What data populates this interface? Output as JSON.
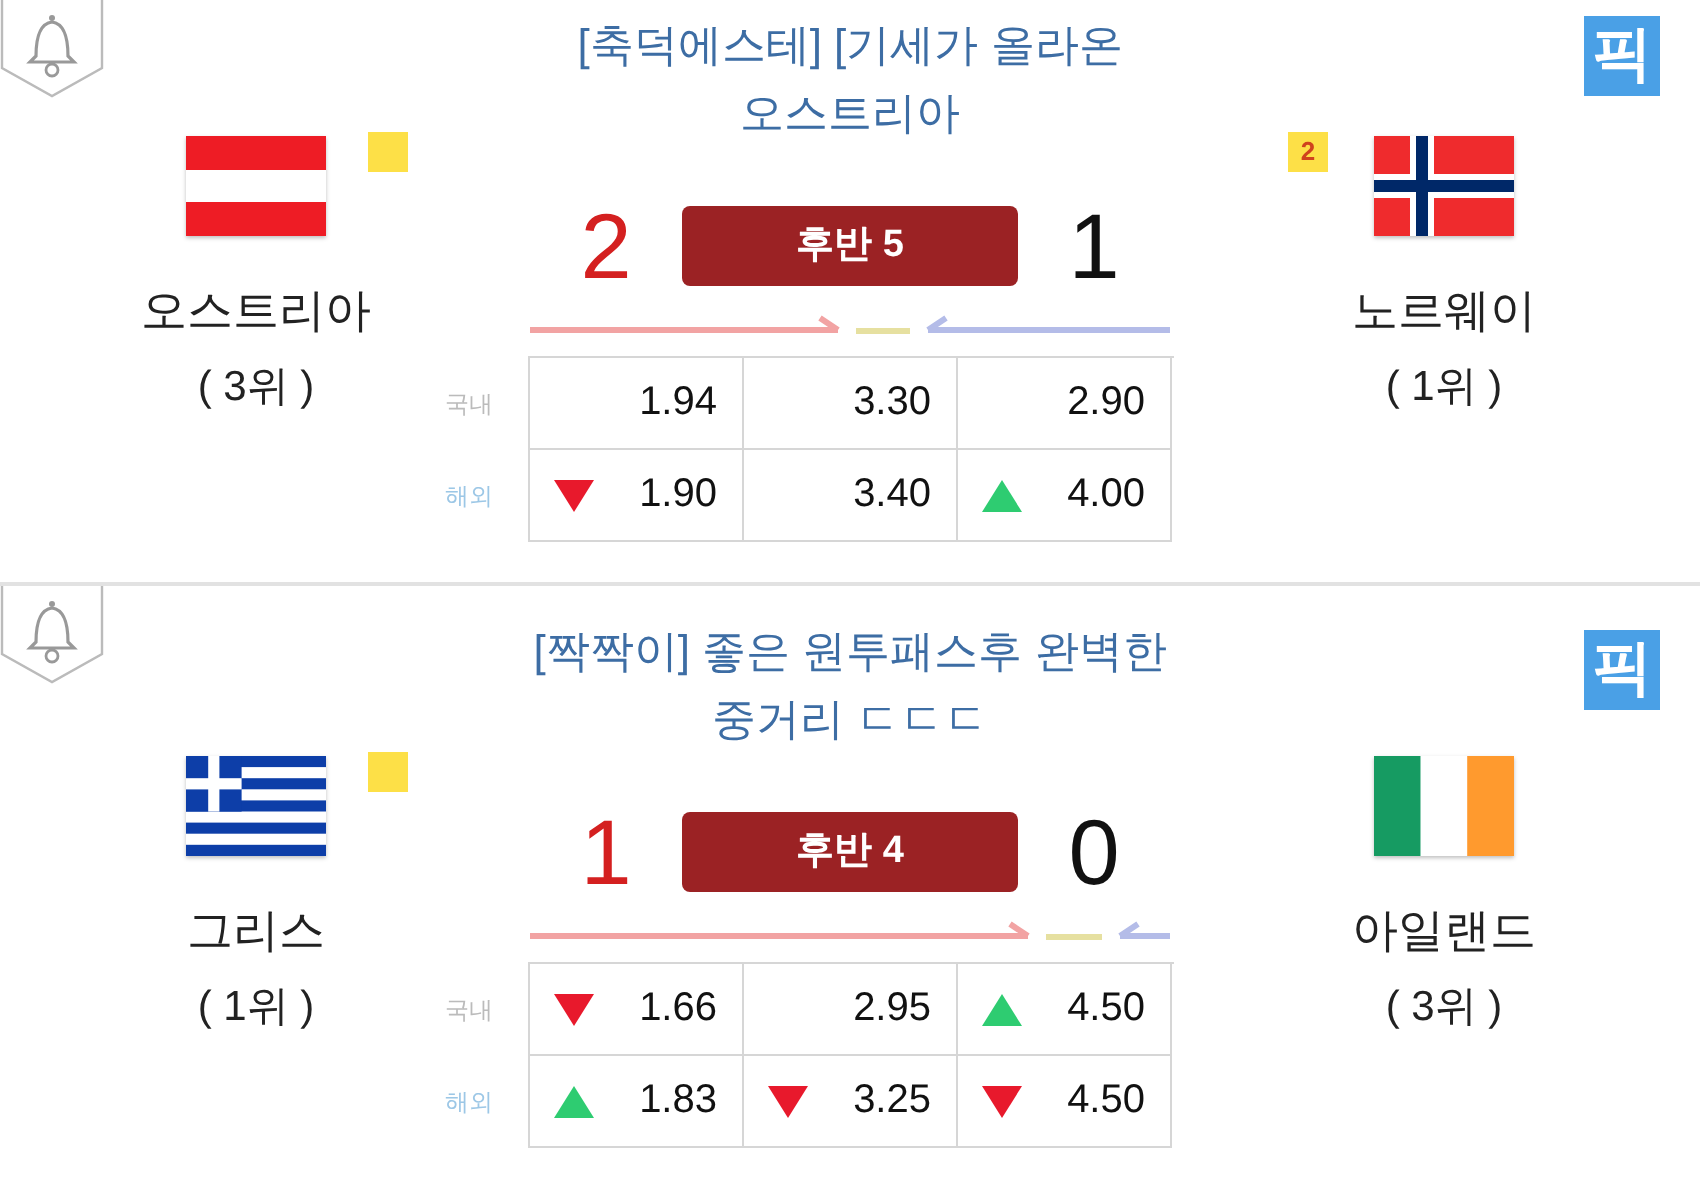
{
  "matches": [
    {
      "title": "[축덕에스테] [기세가 올라온\n오스트리아",
      "pick": "픽",
      "status": "후반 5",
      "home_score": "2",
      "away_score": "1",
      "home": {
        "name": "오스트리아",
        "rank": "( 3위 )",
        "flag": {
          "kind": "austria"
        },
        "yellow_card": true
      },
      "away": {
        "name": "노르웨이",
        "rank": "( 1위 )",
        "flag": {
          "kind": "norway"
        },
        "yellow_card": true,
        "yellow_card_count": "2"
      },
      "trends": [
        {
          "kind": "home"
        },
        {
          "kind": "draw"
        },
        {
          "kind": "away"
        }
      ],
      "odds": [
        {
          "label": "국내",
          "cells": [
            {
              "value": "1.94",
              "kind": "plain"
            },
            {
              "value": "3.30",
              "kind": "plain"
            },
            {
              "value": "2.90",
              "kind": "plain"
            }
          ]
        },
        {
          "label": "해외",
          "cells": [
            {
              "value": "1.90",
              "kind": "down"
            },
            {
              "value": "3.40",
              "kind": "plain"
            },
            {
              "value": "4.00",
              "kind": "up"
            }
          ]
        }
      ]
    },
    {
      "title": "[짝짝이] 좋은 원투패스후 완벽한\n중거리 ㄷㄷㄷ",
      "pick": "픽",
      "status": "후반 4",
      "home_score": "1",
      "away_score": "0",
      "home": {
        "name": "그리스",
        "rank": "( 1위 )",
        "flag": {
          "kind": "greece"
        },
        "yellow_card": true
      },
      "away": {
        "name": "아일랜드",
        "rank": "( 3위 )",
        "flag": {
          "kind": "ireland"
        },
        "yellow_card": false
      },
      "trends": [
        {
          "kind": "home"
        },
        {
          "kind": "draw"
        },
        {
          "kind": "away"
        }
      ],
      "odds": [
        {
          "label": "국내",
          "cells": [
            {
              "value": "1.66",
              "kind": "down"
            },
            {
              "value": "2.95",
              "kind": "plain"
            },
            {
              "value": "4.50",
              "kind": "up"
            }
          ]
        },
        {
          "label": "해외",
          "cells": [
            {
              "value": "1.83",
              "kind": "up"
            },
            {
              "value": "3.25",
              "kind": "down"
            },
            {
              "value": "4.50",
              "kind": "down"
            }
          ]
        }
      ]
    }
  ]
}
